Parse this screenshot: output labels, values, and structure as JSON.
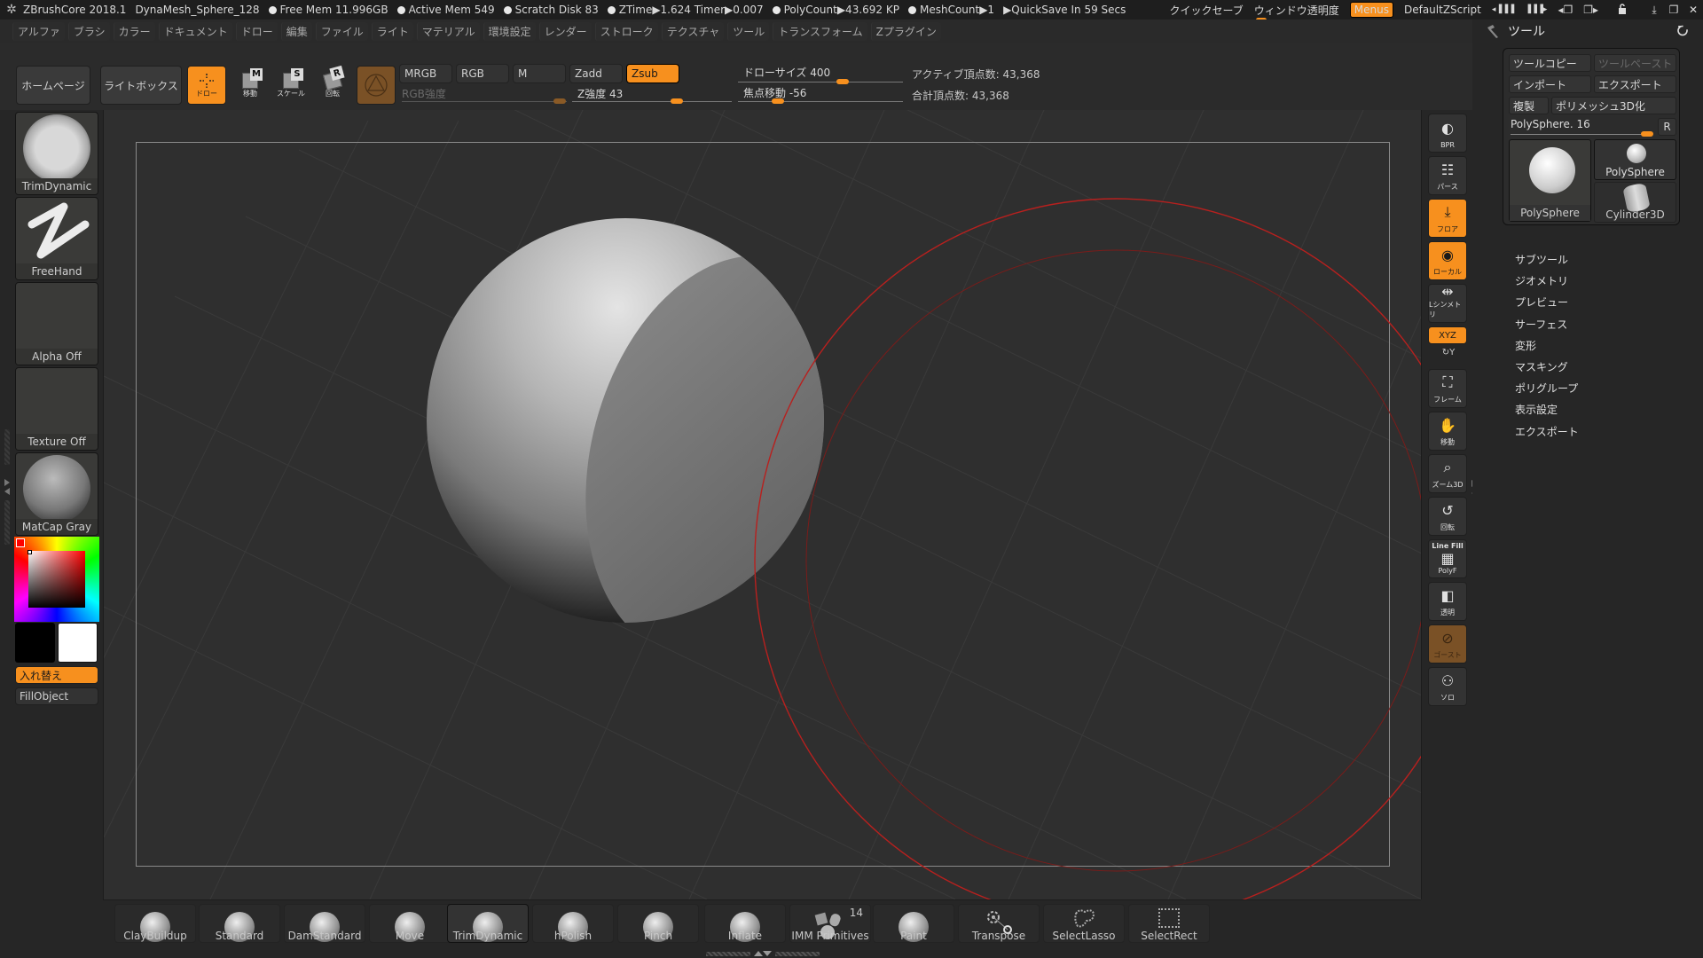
{
  "titlebar": {
    "app": "ZBrushCore 2018.1",
    "document": "DynaMesh_Sphere_128",
    "stats": [
      "Free Mem 11.996GB",
      "Active Mem 549",
      "Scratch Disk 83",
      "ZTime▶1.624 Timer▶0.007",
      "PolyCount▶43.692 KP",
      "MeshCount▶1"
    ],
    "quicksave": "▶QuickSave In 59 Secs",
    "quick_save_label": "クイックセーブ",
    "window_transparency_label": "ウィンドウ透明度",
    "menus_label": "Menus",
    "zscript_label": "DefaultZScript",
    "layout_prev": "◂▐▐▐",
    "layout_next": "▐▐▐▸",
    "color_prev": "◂❐",
    "color_next": "❐▸",
    "lock_icon": "🔓",
    "minimize": "⤓",
    "restore": "❐",
    "close": "✕"
  },
  "menubar": {
    "items": [
      "アルファ",
      "ブラシ",
      "カラー",
      "ドキュメント",
      "ドロー",
      "編集",
      "ファイル",
      "ライト",
      "マテリアル",
      "環境設定",
      "レンダー",
      "ストローク",
      "テクスチャ",
      "ツール",
      "トランスフォーム",
      "Zプラグイン"
    ]
  },
  "toolbar": {
    "home_label": "ホームページ",
    "lightbox_label": "ライトボックス",
    "draw_label": "ドロー",
    "move_label": "移動",
    "move_key": "M",
    "scale_label": "スケール",
    "scale_key": "S",
    "rotate_label": "回転",
    "rotate_key": "R",
    "mrgb": "MRGB",
    "rgb": "RGB",
    "m": "M",
    "zadd": "Zadd",
    "zsub": "Zsub",
    "rgb_intensity_label": "RGB強度",
    "z_intensity_label": "Z強度 43",
    "z_intensity_value": 43,
    "draw_size_label": "ドローサイズ 400",
    "draw_size_value": 400,
    "focal_shift_label": "焦点移動 -56",
    "focal_shift_value": -56,
    "active_points": "アクティブ頂点数: 43,368",
    "total_points": "合計頂点数: 43,368"
  },
  "leftshelf": {
    "brush": "TrimDynamic",
    "stroke": "FreeHand",
    "alpha": "Alpha Off",
    "texture": "Texture Off",
    "material": "MatCap Gray",
    "swap_label": "入れ替え",
    "fill_label": "FillObject",
    "main_color": "#000000",
    "secondary_color": "#ffffff",
    "picker_hue": "#ff0000"
  },
  "rightshelf": {
    "items": [
      {
        "label": "BPR",
        "state": "normal"
      },
      {
        "label": "パース",
        "state": "normal"
      },
      {
        "label": "フロア",
        "state": "on"
      },
      {
        "label": "ローカル",
        "state": "on"
      },
      {
        "label": "Lシンメトリ",
        "state": "normal"
      },
      {
        "label": "XYZ",
        "state": "on"
      },
      {
        "label": "Y",
        "state": "plain"
      },
      {
        "label": "フレーム",
        "state": "normal"
      },
      {
        "label": "移動",
        "state": "normal"
      },
      {
        "label": "ズーム3D",
        "state": "normal"
      },
      {
        "label": "回転",
        "state": "normal"
      },
      {
        "label": "PolyF",
        "state": "normal",
        "top": "Line Fill"
      },
      {
        "label": "透明",
        "state": "normal"
      },
      {
        "label": "ゴースト",
        "state": "brown"
      },
      {
        "label": "ソロ",
        "state": "normal"
      }
    ]
  },
  "bottombar": {
    "brushes": [
      {
        "label": "ClayBuildup"
      },
      {
        "label": "Standard"
      },
      {
        "label": "DamStandard"
      },
      {
        "label": "Move"
      },
      {
        "label": "TrimDynamic",
        "selected": true
      },
      {
        "label": "hPolish"
      },
      {
        "label": "Pinch"
      },
      {
        "label": "Inflate"
      },
      {
        "label": "IMM Primitives",
        "badge": "14"
      },
      {
        "label": "Paint"
      },
      {
        "label": "Transpose"
      },
      {
        "label": "SelectLasso"
      },
      {
        "label": "SelectRect"
      }
    ]
  },
  "rightpanel": {
    "title": "ツール",
    "copy_tool": "ツールコピー",
    "paste_tool": "ツールペースト",
    "import": "インポート",
    "export": "エクスポート",
    "clone": "複製",
    "make_polymesh": "ポリメッシュ3D化",
    "current_tool": "PolySphere. 16",
    "r_label": "R",
    "tools": [
      "PolySphere",
      "PolySphere",
      "Cylinder3D"
    ],
    "subpalettes": [
      "サブツール",
      "ジオメトリ",
      "プレビュー",
      "サーフェス",
      "変形",
      "マスキング",
      "ポリグループ",
      "表示設定",
      "エクスポート"
    ]
  },
  "colors": {
    "accent": "#f7901e",
    "brush_cursor": "#c0201e"
  }
}
